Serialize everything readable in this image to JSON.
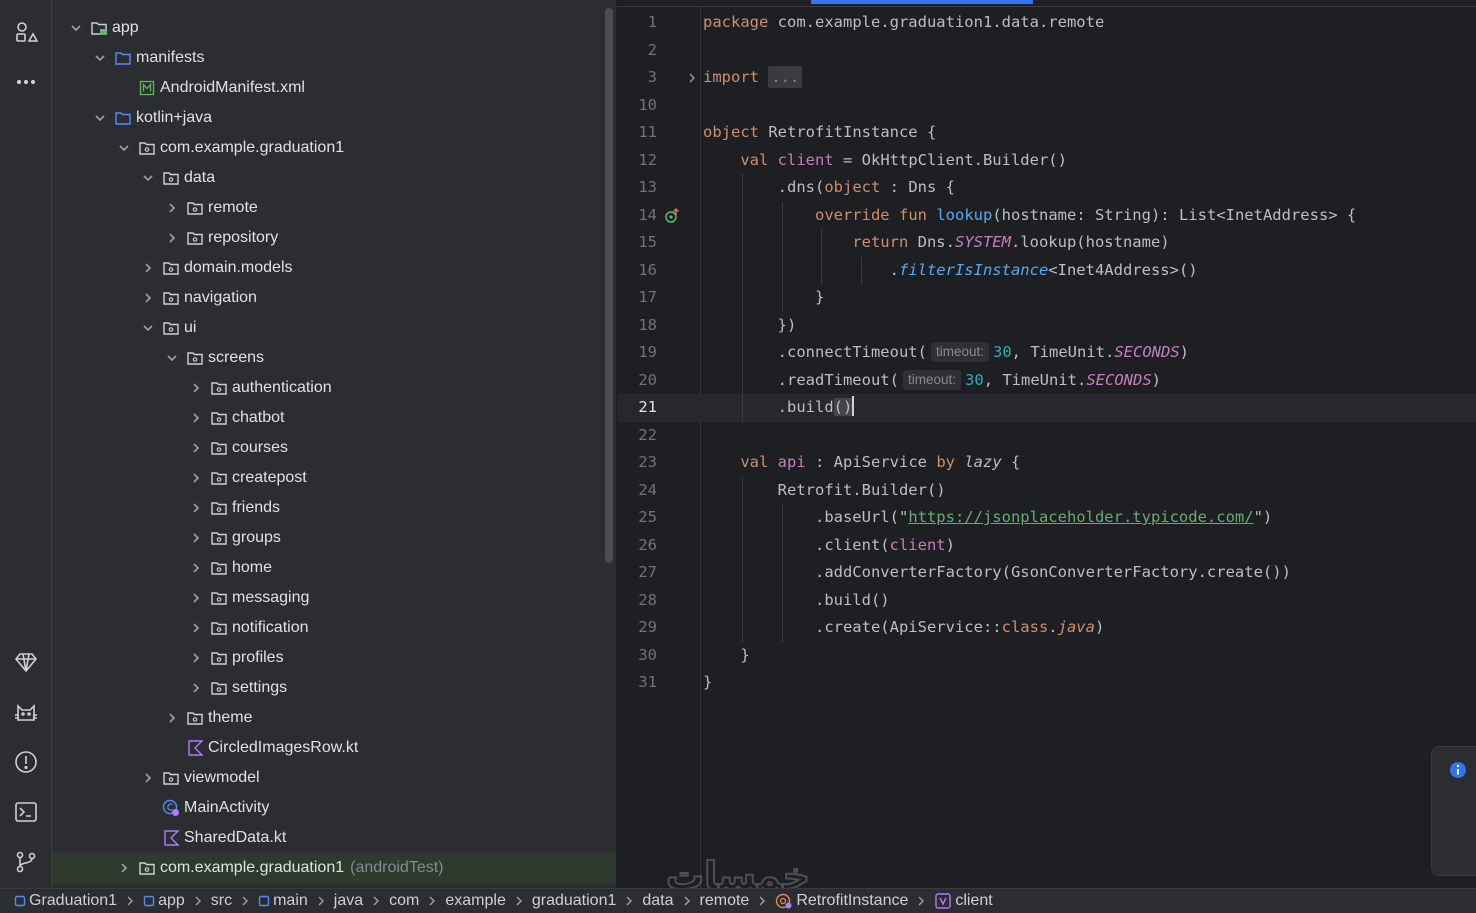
{
  "project_tree": [
    {
      "label": "app",
      "depth": 0,
      "expanded": true,
      "icon": "module-folder-icon"
    },
    {
      "label": "manifests",
      "depth": 1,
      "expanded": true,
      "icon": "folder-icon"
    },
    {
      "label": "AndroidManifest.xml",
      "depth": 2,
      "icon": "manifest-file-icon"
    },
    {
      "label": "kotlin+java",
      "depth": 1,
      "expanded": true,
      "icon": "folder-icon"
    },
    {
      "label": "com.example.graduation1",
      "depth": 2,
      "expanded": true,
      "icon": "package-icon"
    },
    {
      "label": "data",
      "depth": 3,
      "expanded": true,
      "icon": "package-icon"
    },
    {
      "label": "remote",
      "depth": 4,
      "expanded": false,
      "icon": "package-icon"
    },
    {
      "label": "repository",
      "depth": 4,
      "expanded": false,
      "icon": "package-icon"
    },
    {
      "label": "domain.models",
      "depth": 3,
      "expanded": false,
      "icon": "package-icon"
    },
    {
      "label": "navigation",
      "depth": 3,
      "expanded": false,
      "icon": "package-icon"
    },
    {
      "label": "ui",
      "depth": 3,
      "expanded": true,
      "icon": "package-icon"
    },
    {
      "label": "screens",
      "depth": 4,
      "expanded": true,
      "icon": "package-icon"
    },
    {
      "label": "authentication",
      "depth": 5,
      "expanded": false,
      "icon": "package-icon"
    },
    {
      "label": "chatbot",
      "depth": 5,
      "expanded": false,
      "icon": "package-icon"
    },
    {
      "label": "courses",
      "depth": 5,
      "expanded": false,
      "icon": "package-icon"
    },
    {
      "label": "createpost",
      "depth": 5,
      "expanded": false,
      "icon": "package-icon"
    },
    {
      "label": "friends",
      "depth": 5,
      "expanded": false,
      "icon": "package-icon"
    },
    {
      "label": "groups",
      "depth": 5,
      "expanded": false,
      "icon": "package-icon"
    },
    {
      "label": "home",
      "depth": 5,
      "expanded": false,
      "icon": "package-icon"
    },
    {
      "label": "messaging",
      "depth": 5,
      "expanded": false,
      "icon": "package-icon"
    },
    {
      "label": "notification",
      "depth": 5,
      "expanded": false,
      "icon": "package-icon"
    },
    {
      "label": "profiles",
      "depth": 5,
      "expanded": false,
      "icon": "package-icon"
    },
    {
      "label": "settings",
      "depth": 5,
      "expanded": false,
      "icon": "package-icon"
    },
    {
      "label": "theme",
      "depth": 4,
      "expanded": false,
      "icon": "package-icon"
    },
    {
      "label": "CircledImagesRow.kt",
      "depth": 4,
      "icon": "kotlin-file-icon"
    },
    {
      "label": "viewmodel",
      "depth": 3,
      "expanded": false,
      "icon": "package-icon"
    },
    {
      "label": "MainActivity",
      "depth": 3,
      "icon": "activity-class-icon"
    },
    {
      "label": "SharedData.kt",
      "depth": 3,
      "icon": "kotlin-file-icon"
    },
    {
      "label": "com.example.graduation1",
      "suffix": "(androidTest)",
      "depth": 2,
      "expanded": false,
      "icon": "package-icon",
      "selected": true
    }
  ],
  "editor": {
    "line_numbers": [
      "1",
      "2",
      "3",
      "10",
      "11",
      "12",
      "13",
      "14",
      "15",
      "16",
      "17",
      "18",
      "19",
      "20",
      "21",
      "22",
      "23",
      "24",
      "25",
      "26",
      "27",
      "28",
      "29",
      "30",
      "31"
    ],
    "current_line": "21",
    "import_fold": "...",
    "hints": {
      "timeout": "timeout:"
    },
    "tokens": {
      "package": "package",
      "package_name": " com.example.graduation1.data.remote",
      "import": "import",
      "object": "object",
      "object_name": " RetrofitInstance {",
      "val": "val",
      "client": "client",
      "okhttp_builder": " = OkHttpClient.Builder()",
      "dns_call": ".dns(",
      "dns_type": " : Dns {",
      "override": "override",
      "fun": "fun",
      "lookup": "lookup",
      "lookup_sig": "(hostname: String): List<InetAddress> {",
      "return": "return",
      "dns_prefix": " Dns.",
      "system": "SYSTEM",
      "lookup_call": ".lookup(hostname)",
      "dot": ".",
      "filter": "filterIsInstance",
      "filter_type": "<Inet4Address>()",
      "close_brace": "}",
      "close_paren": "})",
      "connect_timeout": ".connectTimeout(",
      "read_timeout": ".readTimeout(",
      "timeout_value": "30",
      "time_unit": ", TimeUnit.",
      "seconds": "SECONDS",
      "rparen": ")",
      "build_call": ".build",
      "build_parens": "()",
      "api": "api",
      "api_type": " : ApiService ",
      "by": "by",
      "lazy": "lazy",
      "lbrace": " {",
      "retrofit_builder": "Retrofit.Builder()",
      "base_url_open": ".baseUrl(\"",
      "base_url": "https://jsonplaceholder.typicode.com/",
      "base_url_close": "\")",
      "client_call_open": ".client(",
      "converter": ".addConverterFactory(GsonConverterFactory.create())",
      "build_plain": ".build()",
      "create_open": ".create(ApiService::",
      "class_kw": "class",
      "java": "java"
    }
  },
  "statusbar": {
    "crumbs": [
      "Graduation1",
      "app",
      "src",
      "main",
      "java",
      "com",
      "example",
      "graduation1",
      "data",
      "remote",
      "RetrofitInstance",
      "client"
    ]
  },
  "watermark": "خمسات",
  "colors": {
    "accent": "#3574f0",
    "keyword": "#cf8e6d",
    "function": "#56a8f5",
    "string": "#6aab73",
    "number": "#2aacb8",
    "property": "#c77dbb"
  }
}
